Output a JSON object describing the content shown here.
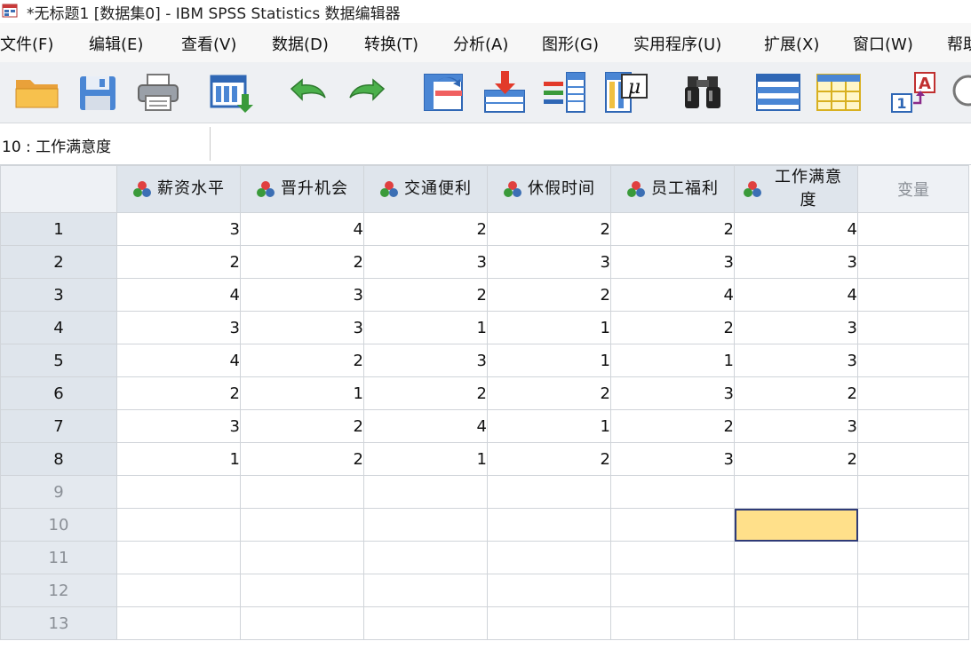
{
  "window": {
    "title": "*无标题1 [数据集0] - IBM SPSS Statistics 数据编辑器"
  },
  "menu": [
    {
      "label": "文件(F)"
    },
    {
      "label": "编辑(E)"
    },
    {
      "label": "查看(V)"
    },
    {
      "label": "数据(D)"
    },
    {
      "label": "转换(T)"
    },
    {
      "label": "分析(A)"
    },
    {
      "label": "图形(G)"
    },
    {
      "label": "实用程序(U)"
    },
    {
      "label": "扩展(X)"
    },
    {
      "label": "窗口(W)"
    },
    {
      "label": "帮助"
    }
  ],
  "toolbar": {
    "buttons": [
      "open-folder-icon",
      "save-icon",
      "print-icon",
      "dialog-recall-icon",
      "undo-icon",
      "redo-icon",
      "goto-case-icon",
      "goto-variable-icon",
      "variables-icon",
      "statistics-icon",
      "find-icon",
      "insert-cases-icon",
      "insert-variable-icon",
      "value-labels-icon",
      "search-icon"
    ],
    "statistics_glyph": "μ",
    "value_labels_glyph_a": "A",
    "value_labels_glyph_1": "1"
  },
  "cell_ref": {
    "label": "10 : 工作满意度",
    "value": ""
  },
  "grid": {
    "columns": [
      "薪资水平",
      "晋升机会",
      "交通便利",
      "休假时间",
      "员工福利",
      "工作满意度"
    ],
    "empty_column_label": "变量",
    "row_numbers": [
      "1",
      "2",
      "3",
      "4",
      "5",
      "6",
      "7",
      "8",
      "9",
      "10",
      "11",
      "12",
      "13"
    ],
    "rows": [
      [
        "3",
        "4",
        "2",
        "2",
        "2",
        "4"
      ],
      [
        "2",
        "2",
        "3",
        "3",
        "3",
        "3"
      ],
      [
        "4",
        "3",
        "2",
        "2",
        "4",
        "4"
      ],
      [
        "3",
        "3",
        "1",
        "1",
        "2",
        "3"
      ],
      [
        "4",
        "2",
        "3",
        "1",
        "1",
        "3"
      ],
      [
        "2",
        "1",
        "2",
        "2",
        "3",
        "2"
      ],
      [
        "3",
        "2",
        "4",
        "1",
        "2",
        "3"
      ],
      [
        "1",
        "2",
        "1",
        "2",
        "3",
        "2"
      ]
    ],
    "selected_cell": {
      "row": "10",
      "column": "工作满意度"
    }
  },
  "colors": {
    "header_bg": "#dfe5ec",
    "selection": "#ffe08a",
    "selection_border": "#2f3b77"
  }
}
